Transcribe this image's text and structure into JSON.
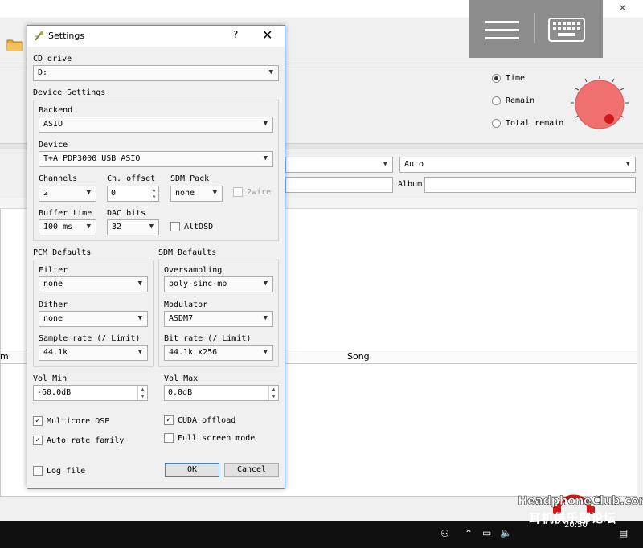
{
  "background_app": {
    "playback": {
      "options": [
        {
          "label": "Time",
          "selected": true
        },
        {
          "label": "Remain",
          "selected": false
        },
        {
          "label": "Total remain",
          "selected": false
        }
      ]
    },
    "auto_combo_value": "Auto",
    "album_label": "Album",
    "columns": {
      "left_partial": "m",
      "song": "Song"
    }
  },
  "dialog": {
    "title": "Settings",
    "help": "?",
    "close": "✕",
    "cd_drive": {
      "label": "CD drive",
      "value": "D:"
    },
    "device_settings": {
      "label": "Device Settings",
      "backend": {
        "label": "Backend",
        "value": "ASIO"
      },
      "device": {
        "label": "Device",
        "value": "T+A PDP3000 USB ASIO"
      },
      "channels": {
        "label": "Channels",
        "value": "2"
      },
      "ch_offset": {
        "label": "Ch. offset",
        "value": "0"
      },
      "sdm_pack": {
        "label": "SDM Pack",
        "value": "none"
      },
      "twowire": {
        "label": "2wire",
        "checked": false
      },
      "buffer_time": {
        "label": "Buffer time",
        "value": "100 ms"
      },
      "dac_bits": {
        "label": "DAC bits",
        "value": "32"
      },
      "altdsd": {
        "label": "AltDSD",
        "checked": false
      }
    },
    "pcm_defaults": {
      "label": "PCM Defaults",
      "filter": {
        "label": "Filter",
        "value": "none"
      },
      "dither": {
        "label": "Dither",
        "value": "none"
      },
      "sample_rate": {
        "label": "Sample rate (/ Limit)",
        "value": "44.1k"
      }
    },
    "sdm_defaults": {
      "label": "SDM Defaults",
      "oversampling": {
        "label": "Oversampling",
        "value": "poly-sinc-mp"
      },
      "modulator": {
        "label": "Modulator",
        "value": "ASDM7"
      },
      "bit_rate": {
        "label": "Bit rate (/ Limit)",
        "value": "44.1k x256"
      }
    },
    "vol_min": {
      "label": "Vol Min",
      "value": "-60.0dB"
    },
    "vol_max": {
      "label": "Vol Max",
      "value": "0.0dB"
    },
    "multicore_dsp": {
      "label": "Multicore DSP",
      "checked": true
    },
    "cuda_offload": {
      "label": "CUDA offload",
      "checked": true
    },
    "auto_rate_family": {
      "label": "Auto rate family",
      "checked": true
    },
    "full_screen_mode": {
      "label": "Full screen mode",
      "checked": false
    },
    "log_file": {
      "label": "Log file",
      "checked": false
    },
    "ok": "OK",
    "cancel": "Cancel"
  },
  "taskbar": {
    "time": "20:50"
  },
  "watermark": {
    "top": "HeadphoneClub.com",
    "bottom": "耳机俱乐部论坛"
  },
  "colors": {
    "knob_fill": "#f07070",
    "knob_indicator": "#d01818",
    "dialog_border": "#5a8fd6",
    "overlay_panel": "#8c8c8c",
    "taskbar": "#101010"
  },
  "icons": [
    "folder-icon",
    "hamburger-icon",
    "keyboard-icon",
    "settings-app-icon",
    "checkmark-icon",
    "chevron-down-icon"
  ]
}
